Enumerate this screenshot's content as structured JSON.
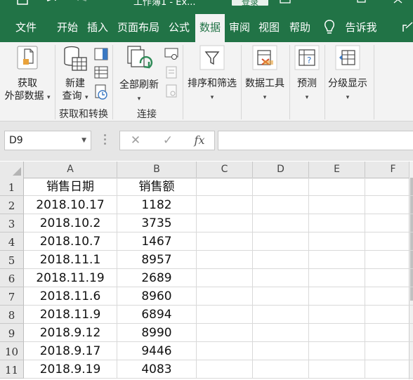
{
  "titlebar": {
    "doc_title": "工作簿1 - Ex...",
    "login_label": "登录"
  },
  "ribbon_tabs": [
    {
      "label": "文件",
      "active": false
    },
    {
      "label": "开始",
      "active": false
    },
    {
      "label": "插入",
      "active": false
    },
    {
      "label": "页面布局",
      "active": false
    },
    {
      "label": "公式",
      "active": false
    },
    {
      "label": "数据",
      "active": true
    },
    {
      "label": "审阅",
      "active": false
    },
    {
      "label": "视图",
      "active": false
    },
    {
      "label": "帮助",
      "active": false
    }
  ],
  "tell_me": {
    "label": "告诉我",
    "icon": "lightbulb-icon"
  },
  "ribbon": {
    "get_external_data": {
      "line1": "获取",
      "line2": "外部数据"
    },
    "new_query": {
      "line1": "新建",
      "line2": "查询"
    },
    "group_get_transform": "获取和转换",
    "refresh_all": "全部刷新",
    "group_connections": "连接",
    "sort_filter": "排序和筛选",
    "data_tools": "数据工具",
    "forecast": "预测",
    "outline": "分级显示"
  },
  "formula_bar": {
    "name_box": "D9",
    "fx_label": "fx",
    "formula": ""
  },
  "grid": {
    "columns": [
      "A",
      "B",
      "C",
      "D",
      "E",
      "F"
    ],
    "row_numbers": [
      "1",
      "2",
      "3",
      "4",
      "5",
      "6",
      "7",
      "8",
      "9",
      "10",
      "11"
    ],
    "rows": [
      [
        "销售日期",
        "销售额"
      ],
      [
        "2018.10.17",
        "1182"
      ],
      [
        "2018.10.2",
        "3735"
      ],
      [
        "2018.10.7",
        "1467"
      ],
      [
        "2018.11.1",
        "8957"
      ],
      [
        "2018.11.19",
        "2689"
      ],
      [
        "2018.11.6",
        "8960"
      ],
      [
        "2018.11.9",
        "6894"
      ],
      [
        "2018.9.12",
        "8990"
      ],
      [
        "2018.9.17",
        "9446"
      ],
      [
        "2018.9.19",
        "4083"
      ]
    ],
    "selected_cell": "D9"
  },
  "colors": {
    "accent": "#217346",
    "ribbon_bg": "#f3f3f3",
    "header_bg": "#e9e9e9"
  }
}
